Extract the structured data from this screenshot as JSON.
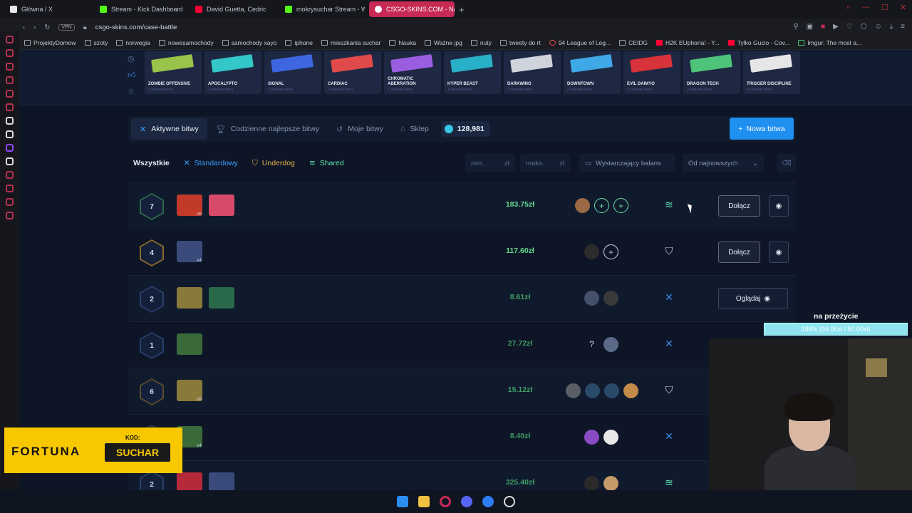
{
  "browser": {
    "tabs": [
      {
        "title": "Główna / X",
        "color": "#e7e9ea"
      },
      {
        "title": "Stream - Kick Dashboard",
        "color": "#53fc18"
      },
      {
        "title": "David Guetta, Cedric",
        "color": "#ff0033"
      },
      {
        "title": "mokrysuchar Stream - W",
        "color": "#53fc18"
      },
      {
        "title": "CSGO-SKINS.COM - Naj",
        "color": "#ffffff"
      }
    ],
    "new_tab": "+",
    "vpn": "VPN",
    "url": "csgo-skins.com/case-battle",
    "bookmarks": [
      "ProjektyDomow",
      "szoty",
      "norwegia",
      "nowesamochody",
      "samochody xayo",
      "iphone",
      "mieszkania suchar",
      "Nauka",
      "Ważne jpg",
      "nuty",
      "tweety do rt",
      "94 League of Leg...",
      "CEIDG",
      "H2K EUphoria! - Y...",
      "Tylko Gucio - Cov...",
      "Imgur: The most a..."
    ]
  },
  "cases": [
    {
      "name": "ZOMBIE OFFENSIVE",
      "sub": "1 sekundy temu",
      "color": "#9ac34a"
    },
    {
      "name": "APOCALYPTO",
      "sub": "1 sekundy temu",
      "color": "#33c7c7"
    },
    {
      "name": "SIGNAL",
      "sub": "1 sekundy temu",
      "color": "#3d66e0"
    },
    {
      "name": "CARDIAC",
      "sub": "1 sekundy temu",
      "color": "#e04a4a"
    },
    {
      "name": "CHROMATIC ABERRATION",
      "sub": "1 sekundy temu",
      "color": "#9a5de0"
    },
    {
      "name": "HYPER BEAST",
      "sub": "1 sekundy temu",
      "color": "#29b0c9"
    },
    {
      "name": "DARKWING",
      "sub": "2 sekundy temu",
      "color": "#cfd4dc"
    },
    {
      "name": "DOWNTOWN",
      "sub": "2 sekundy temu",
      "color": "#3fa9e8"
    },
    {
      "name": "EVIL DAIMYO",
      "sub": "3 sekundy temu",
      "color": "#d8323a"
    },
    {
      "name": "DRAGON TECH",
      "sub": "3 sekundy temu",
      "color": "#4ec37a"
    },
    {
      "name": "TRIGGER DISCIPLINE",
      "sub": "4 sekundy temu",
      "color": "#e6e6e6"
    }
  ],
  "nav": {
    "tabs": [
      "Aktywne bitwy",
      "Codzienne najlepsze bitwy",
      "Moje bitwy",
      "Sklep"
    ],
    "balance": "128,981",
    "new_battle": "Nowa bitwa"
  },
  "filters": {
    "types": [
      "Wszystkie",
      "Standardowy",
      "Underdog",
      "Shared"
    ],
    "min_placeholder": "min.",
    "max_placeholder": "maks.",
    "currency": "zł",
    "sufficient_balance": "Wystarczający balans",
    "sort": "Od najnowszych"
  },
  "rows": [
    {
      "rounds": "7",
      "price": "183.75zł",
      "mode": "shared",
      "mult": "x6",
      "action": "Dołącz"
    },
    {
      "rounds": "4",
      "price": "117.60zł",
      "mode": "underdog",
      "mult": "x4",
      "action": "Dołącz"
    },
    {
      "rounds": "2",
      "price": "8.61zł",
      "mode": "standard",
      "mult": "",
      "action": "Oglądaj"
    },
    {
      "rounds": "1",
      "price": "27.72zł",
      "mode": "standard",
      "mult": "",
      "action": "",
      "unknown": "?"
    },
    {
      "rounds": "6",
      "price": "15.12zł",
      "mode": "underdog",
      "mult": "x6",
      "action": ""
    },
    {
      "rounds": "",
      "price": "8.40zł",
      "mode": "standard",
      "mult": "x4",
      "action": ""
    },
    {
      "rounds": "2",
      "price": "325.40zł",
      "mode": "shared",
      "mult": "",
      "action": ""
    }
  ],
  "overlay": {
    "goal_title": "na przeżycie",
    "goal_text": "188% (94.00zł / 50.00zł)",
    "promo_brand": "FORTUNA",
    "promo_kod": "KOD:",
    "promo_code": "SUCHAR"
  }
}
